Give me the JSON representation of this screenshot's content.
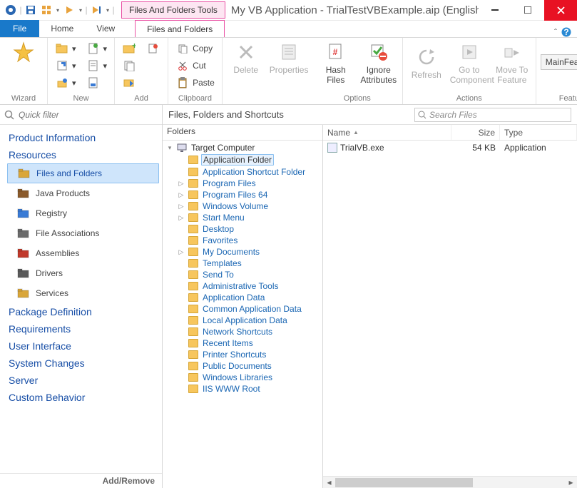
{
  "title": "My VB Application - TrialTestVBExample.aip (English ...",
  "contextual_tab_label": "Files And Folders Tools",
  "tabs": {
    "file": "File",
    "home": "Home",
    "view": "View",
    "files_folders": "Files and Folders"
  },
  "ribbon": {
    "wizard": {
      "label": "Wizard"
    },
    "new": {
      "label": "New"
    },
    "add": {
      "label": "Add"
    },
    "clipboard": {
      "label": "Clipboard",
      "copy": "Copy",
      "cut": "Cut",
      "paste": "Paste"
    },
    "delete": {
      "label": "Delete"
    },
    "properties": {
      "label": "Properties"
    },
    "hash": {
      "label": "Hash Files"
    },
    "ignore": {
      "label": "Ignore Attributes"
    },
    "options_group": "Options",
    "refresh": {
      "label": "Refresh"
    },
    "goto": {
      "label": "Go to Component"
    },
    "moveto": {
      "label": "Move To Feature"
    },
    "actions_group": "Actions",
    "feature_group": "Feature",
    "feature_value": "MainFeature"
  },
  "quick_filter_placeholder": "Quick filter",
  "sidebar": {
    "categories": [
      {
        "key": "product_information",
        "label": "Product Information",
        "items": []
      },
      {
        "key": "resources",
        "label": "Resources",
        "items": [
          {
            "key": "files_folders",
            "label": "Files and Folders",
            "selected": true,
            "color": "#d9a63a"
          },
          {
            "key": "java_products",
            "label": "Java Products",
            "color": "#8a5a2b"
          },
          {
            "key": "registry",
            "label": "Registry",
            "color": "#3a7bd5"
          },
          {
            "key": "file_associations",
            "label": "File Associations",
            "color": "#6b6b6b"
          },
          {
            "key": "assemblies",
            "label": "Assemblies",
            "color": "#c0392b"
          },
          {
            "key": "drivers",
            "label": "Drivers",
            "color": "#5a5a5a"
          },
          {
            "key": "services",
            "label": "Services",
            "color": "#d9a63a"
          }
        ]
      },
      {
        "key": "package_definition",
        "label": "Package Definition",
        "items": []
      },
      {
        "key": "requirements",
        "label": "Requirements",
        "items": []
      },
      {
        "key": "user_interface",
        "label": "User Interface",
        "items": []
      },
      {
        "key": "system_changes",
        "label": "System Changes",
        "items": []
      },
      {
        "key": "server",
        "label": "Server",
        "items": []
      },
      {
        "key": "custom_behavior",
        "label": "Custom Behavior",
        "items": []
      }
    ],
    "add_remove": "Add/Remove"
  },
  "main": {
    "header": "Files, Folders and Shortcuts",
    "search_placeholder": "Search Files",
    "folders_label": "Folders",
    "tree_root": "Target Computer",
    "tree": [
      {
        "label": "Application Folder",
        "selected": true,
        "expander": ""
      },
      {
        "label": "Application Shortcut Folder",
        "expander": ""
      },
      {
        "label": "Program Files",
        "expander": "▷"
      },
      {
        "label": "Program Files 64",
        "expander": "▷"
      },
      {
        "label": "Windows Volume",
        "expander": "▷"
      },
      {
        "label": "Start Menu",
        "expander": "▷"
      },
      {
        "label": "Desktop",
        "expander": ""
      },
      {
        "label": "Favorites",
        "expander": ""
      },
      {
        "label": "My Documents",
        "expander": "▷"
      },
      {
        "label": "Templates",
        "expander": ""
      },
      {
        "label": "Send To",
        "expander": ""
      },
      {
        "label": "Administrative Tools",
        "expander": ""
      },
      {
        "label": "Application Data",
        "expander": ""
      },
      {
        "label": "Common Application Data",
        "expander": ""
      },
      {
        "label": "Local Application Data",
        "expander": ""
      },
      {
        "label": "Network Shortcuts",
        "expander": ""
      },
      {
        "label": "Recent Items",
        "expander": ""
      },
      {
        "label": "Printer Shortcuts",
        "expander": ""
      },
      {
        "label": "Public Documents",
        "expander": ""
      },
      {
        "label": "Windows Libraries",
        "expander": ""
      },
      {
        "label": "IIS WWW Root",
        "expander": ""
      }
    ],
    "columns": {
      "name": "Name",
      "size": "Size",
      "type": "Type"
    },
    "rows": [
      {
        "name": "TrialVB.exe",
        "size": "54 KB",
        "type": "Application"
      }
    ]
  }
}
